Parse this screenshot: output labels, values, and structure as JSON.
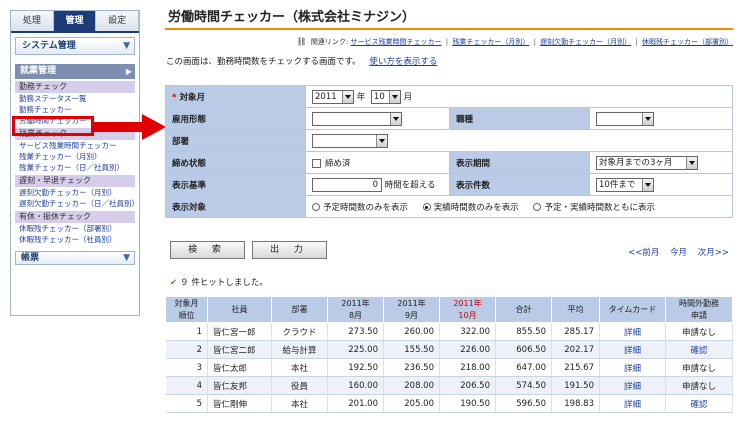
{
  "sidebar": {
    "tabs": [
      "処理",
      "管理",
      "設定"
    ],
    "system_label": "システム管理",
    "section_label": "就業管理",
    "groups": [
      {
        "label": "勤務チェック",
        "items": [
          "勤務ステータス一覧",
          "勤務チェッカー",
          "労働時間チェッカー"
        ]
      },
      {
        "label": "残業チェック",
        "items": [
          "サービス残業時間チェッカー",
          "残業チェッカー（月別）",
          "残業チェッカー（日／社員別）"
        ]
      },
      {
        "label": "遅刻・早退チェック",
        "items": [
          "遅刻欠勤チェッカー（月別）",
          "遅刻欠勤チェッカー（日／社員別）"
        ]
      },
      {
        "label": "有休・振休チェック",
        "items": [
          "休暇残チェッカー（部署別）",
          "休暇残チェッカー（社員別）"
        ]
      }
    ],
    "footer_label": "帳票"
  },
  "header": {
    "title": "労働時間チェッカー（株式会社ミナジン）",
    "related_prefix": "関連リンク:",
    "related_links": [
      "サービス残業時間チェッカー",
      "残業チェッカー（月別）",
      "遅刻欠勤チェッカー（月別）",
      "休暇残チェッカー（部署別）"
    ],
    "description": "この画面は、勤務時間数をチェックする画面です。",
    "howto_link": "使い方を表示する"
  },
  "form": {
    "target_month_label": "対象月",
    "year_value": "2011",
    "year_unit": "年",
    "month_value": "10",
    "month_unit": "月",
    "employment_type_label": "雇用形態",
    "employment_type_value": "",
    "job_type_label": "職種",
    "job_type_value": "",
    "department_label": "部署",
    "department_value": "",
    "closing_status_label": "締め状態",
    "closing_checkbox_label": "締め済",
    "display_period_label": "表示期間",
    "display_period_value": "対象月までの3ヶ月",
    "display_basis_label": "表示基準",
    "basis_value": "0",
    "basis_suffix": "時間を超える",
    "display_count_label": "表示件数",
    "display_count_value": "10件まで",
    "display_target_label": "表示対象",
    "target_options": [
      "予定時間数のみを表示",
      "実績時間数のみを表示",
      "予定・実績時間数ともに表示"
    ],
    "target_selected_index": 1
  },
  "actions": {
    "search_label": "検 索",
    "output_label": "出 力",
    "prev_month": "<<前月",
    "this_month": "今月",
    "next_month": "次月>>"
  },
  "result_message": "９ 件ヒットしました。",
  "table": {
    "headers": [
      "対象月\n順位",
      "社員",
      "部署",
      "2011年\n8月",
      "2011年\n9月",
      "2011年\n10月",
      "合計",
      "平均",
      "タイムカード",
      "時間外勤務\n申請"
    ],
    "rows": [
      [
        "1",
        "皆仁宮一郎",
        "クラウド",
        "273.50",
        "260.00",
        "322.00",
        "855.50",
        "285.17",
        "詳細",
        "申請なし"
      ],
      [
        "2",
        "皆仁宮二郎",
        "給与計算",
        "225.00",
        "155.50",
        "226.00",
        "606.50",
        "202.17",
        "詳細",
        "確認"
      ],
      [
        "3",
        "皆仁太郎",
        "本社",
        "192.50",
        "236.50",
        "218.00",
        "647.00",
        "215.67",
        "詳細",
        "申請なし"
      ],
      [
        "4",
        "皆仁友邦",
        "役員",
        "160.00",
        "208.00",
        "206.50",
        "574.50",
        "191.50",
        "詳細",
        "申請なし"
      ],
      [
        "5",
        "皆仁剛伸",
        "本社",
        "201.00",
        "205.00",
        "190.50",
        "596.50",
        "198.83",
        "詳細",
        "確認"
      ]
    ]
  },
  "colors": {
    "nav_dark": "#1c3d78",
    "label_bg": "#b9cbe6",
    "title_underline": "#f08a00",
    "highlight_red": "#e00000",
    "link": "#1a3fa0"
  }
}
